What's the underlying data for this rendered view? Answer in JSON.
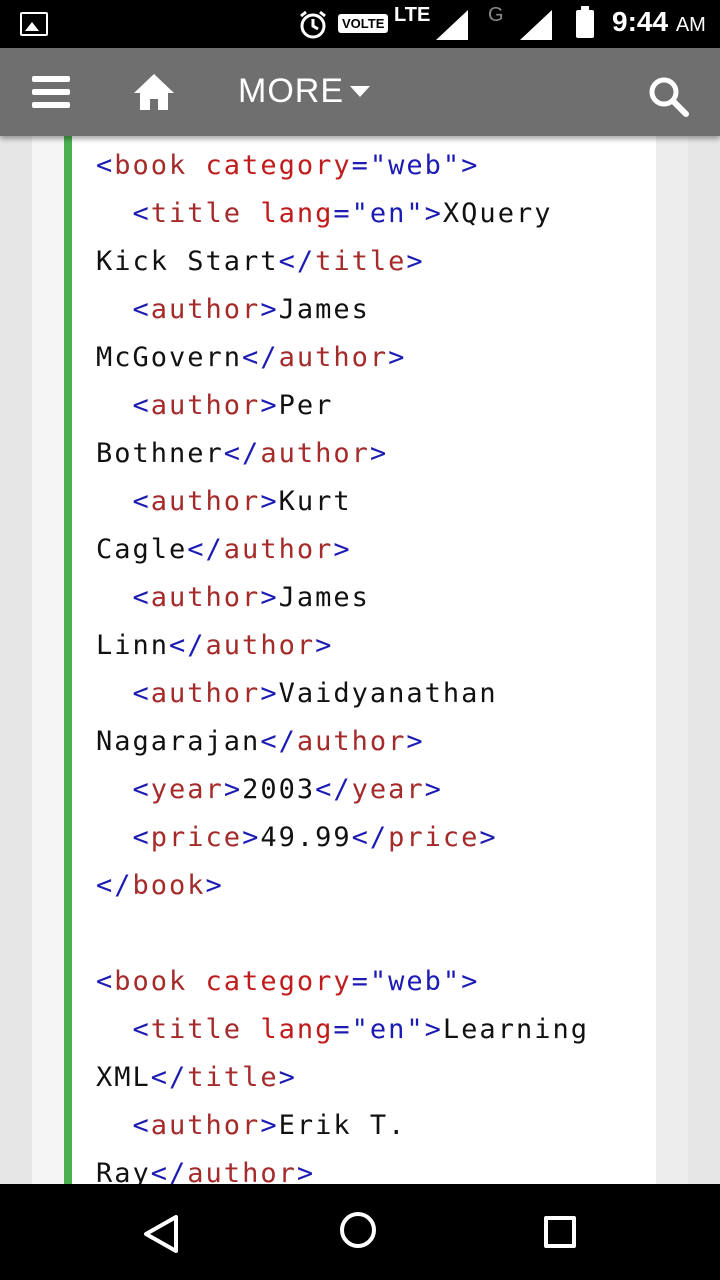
{
  "status_bar": {
    "volte": "VOLTE",
    "lte": "LTE",
    "network_g": "G",
    "time": "9:44",
    "ampm": "AM"
  },
  "app_bar": {
    "more_label": "MORE"
  },
  "code_lines": [
    [
      {
        "c": "br",
        "t": "<"
      },
      {
        "c": "tag",
        "t": "book "
      },
      {
        "c": "attr",
        "t": "category"
      },
      {
        "c": "br",
        "t": "="
      },
      {
        "c": "val",
        "t": "\"web\""
      },
      {
        "c": "br",
        "t": ">"
      }
    ],
    [
      {
        "c": "br",
        "t": "  <"
      },
      {
        "c": "tag",
        "t": "title "
      },
      {
        "c": "attr",
        "t": "lang"
      },
      {
        "c": "br",
        "t": "="
      },
      {
        "c": "val",
        "t": "\"en\""
      },
      {
        "c": "br",
        "t": ">"
      },
      {
        "c": "txt",
        "t": "XQuery"
      }
    ],
    [
      {
        "c": "txt",
        "t": "Kick Start"
      },
      {
        "c": "br",
        "t": "</"
      },
      {
        "c": "tag",
        "t": "title"
      },
      {
        "c": "br",
        "t": ">"
      }
    ],
    [
      {
        "c": "br",
        "t": "  <"
      },
      {
        "c": "tag",
        "t": "author"
      },
      {
        "c": "br",
        "t": ">"
      },
      {
        "c": "txt",
        "t": "James"
      }
    ],
    [
      {
        "c": "txt",
        "t": "McGovern"
      },
      {
        "c": "br",
        "t": "</"
      },
      {
        "c": "tag",
        "t": "author"
      },
      {
        "c": "br",
        "t": ">"
      }
    ],
    [
      {
        "c": "br",
        "t": "  <"
      },
      {
        "c": "tag",
        "t": "author"
      },
      {
        "c": "br",
        "t": ">"
      },
      {
        "c": "txt",
        "t": "Per"
      }
    ],
    [
      {
        "c": "txt",
        "t": "Bothner"
      },
      {
        "c": "br",
        "t": "</"
      },
      {
        "c": "tag",
        "t": "author"
      },
      {
        "c": "br",
        "t": ">"
      }
    ],
    [
      {
        "c": "br",
        "t": "  <"
      },
      {
        "c": "tag",
        "t": "author"
      },
      {
        "c": "br",
        "t": ">"
      },
      {
        "c": "txt",
        "t": "Kurt"
      }
    ],
    [
      {
        "c": "txt",
        "t": "Cagle"
      },
      {
        "c": "br",
        "t": "</"
      },
      {
        "c": "tag",
        "t": "author"
      },
      {
        "c": "br",
        "t": ">"
      }
    ],
    [
      {
        "c": "br",
        "t": "  <"
      },
      {
        "c": "tag",
        "t": "author"
      },
      {
        "c": "br",
        "t": ">"
      },
      {
        "c": "txt",
        "t": "James"
      }
    ],
    [
      {
        "c": "txt",
        "t": "Linn"
      },
      {
        "c": "br",
        "t": "</"
      },
      {
        "c": "tag",
        "t": "author"
      },
      {
        "c": "br",
        "t": ">"
      }
    ],
    [
      {
        "c": "br",
        "t": "  <"
      },
      {
        "c": "tag",
        "t": "author"
      },
      {
        "c": "br",
        "t": ">"
      },
      {
        "c": "txt",
        "t": "Vaidyanathan"
      }
    ],
    [
      {
        "c": "txt",
        "t": "Nagarajan"
      },
      {
        "c": "br",
        "t": "</"
      },
      {
        "c": "tag",
        "t": "author"
      },
      {
        "c": "br",
        "t": ">"
      }
    ],
    [
      {
        "c": "br",
        "t": "  <"
      },
      {
        "c": "tag",
        "t": "year"
      },
      {
        "c": "br",
        "t": ">"
      },
      {
        "c": "txt",
        "t": "2003"
      },
      {
        "c": "br",
        "t": "</"
      },
      {
        "c": "tag",
        "t": "year"
      },
      {
        "c": "br",
        "t": ">"
      }
    ],
    [
      {
        "c": "br",
        "t": "  <"
      },
      {
        "c": "tag",
        "t": "price"
      },
      {
        "c": "br",
        "t": ">"
      },
      {
        "c": "txt",
        "t": "49.99"
      },
      {
        "c": "br",
        "t": "</"
      },
      {
        "c": "tag",
        "t": "price"
      },
      {
        "c": "br",
        "t": ">"
      }
    ],
    [
      {
        "c": "br",
        "t": "</"
      },
      {
        "c": "tag",
        "t": "book"
      },
      {
        "c": "br",
        "t": ">"
      }
    ],
    [],
    [
      {
        "c": "br",
        "t": "<"
      },
      {
        "c": "tag",
        "t": "book "
      },
      {
        "c": "attr",
        "t": "category"
      },
      {
        "c": "br",
        "t": "="
      },
      {
        "c": "val",
        "t": "\"web\""
      },
      {
        "c": "br",
        "t": ">"
      }
    ],
    [
      {
        "c": "br",
        "t": "  <"
      },
      {
        "c": "tag",
        "t": "title "
      },
      {
        "c": "attr",
        "t": "lang"
      },
      {
        "c": "br",
        "t": "="
      },
      {
        "c": "val",
        "t": "\"en\""
      },
      {
        "c": "br",
        "t": ">"
      },
      {
        "c": "txt",
        "t": "Learning"
      }
    ],
    [
      {
        "c": "txt",
        "t": "XML"
      },
      {
        "c": "br",
        "t": "</"
      },
      {
        "c": "tag",
        "t": "title"
      },
      {
        "c": "br",
        "t": ">"
      }
    ],
    [
      {
        "c": "br",
        "t": "  <"
      },
      {
        "c": "tag",
        "t": "author"
      },
      {
        "c": "br",
        "t": ">"
      },
      {
        "c": "txt",
        "t": "Erik T."
      }
    ],
    [
      {
        "c": "txt",
        "t": "Ray"
      },
      {
        "c": "br",
        "t": "</"
      },
      {
        "c": "tag",
        "t": "author"
      },
      {
        "c": "br",
        "t": ">"
      }
    ]
  ],
  "icons": {
    "status": [
      "gallery-notification-icon",
      "alarm-icon",
      "signal-icon",
      "battery-icon"
    ],
    "app_bar": [
      "menu-icon",
      "home-icon",
      "caret-down-icon",
      "search-icon"
    ],
    "nav": [
      "back-icon",
      "home-circle-icon",
      "recents-icon"
    ]
  },
  "colors": {
    "app_bar": "#6f6f6f",
    "accent_bar": "#4caf50",
    "tag": "#a52a2a",
    "bracket": "#1c1cb5"
  }
}
